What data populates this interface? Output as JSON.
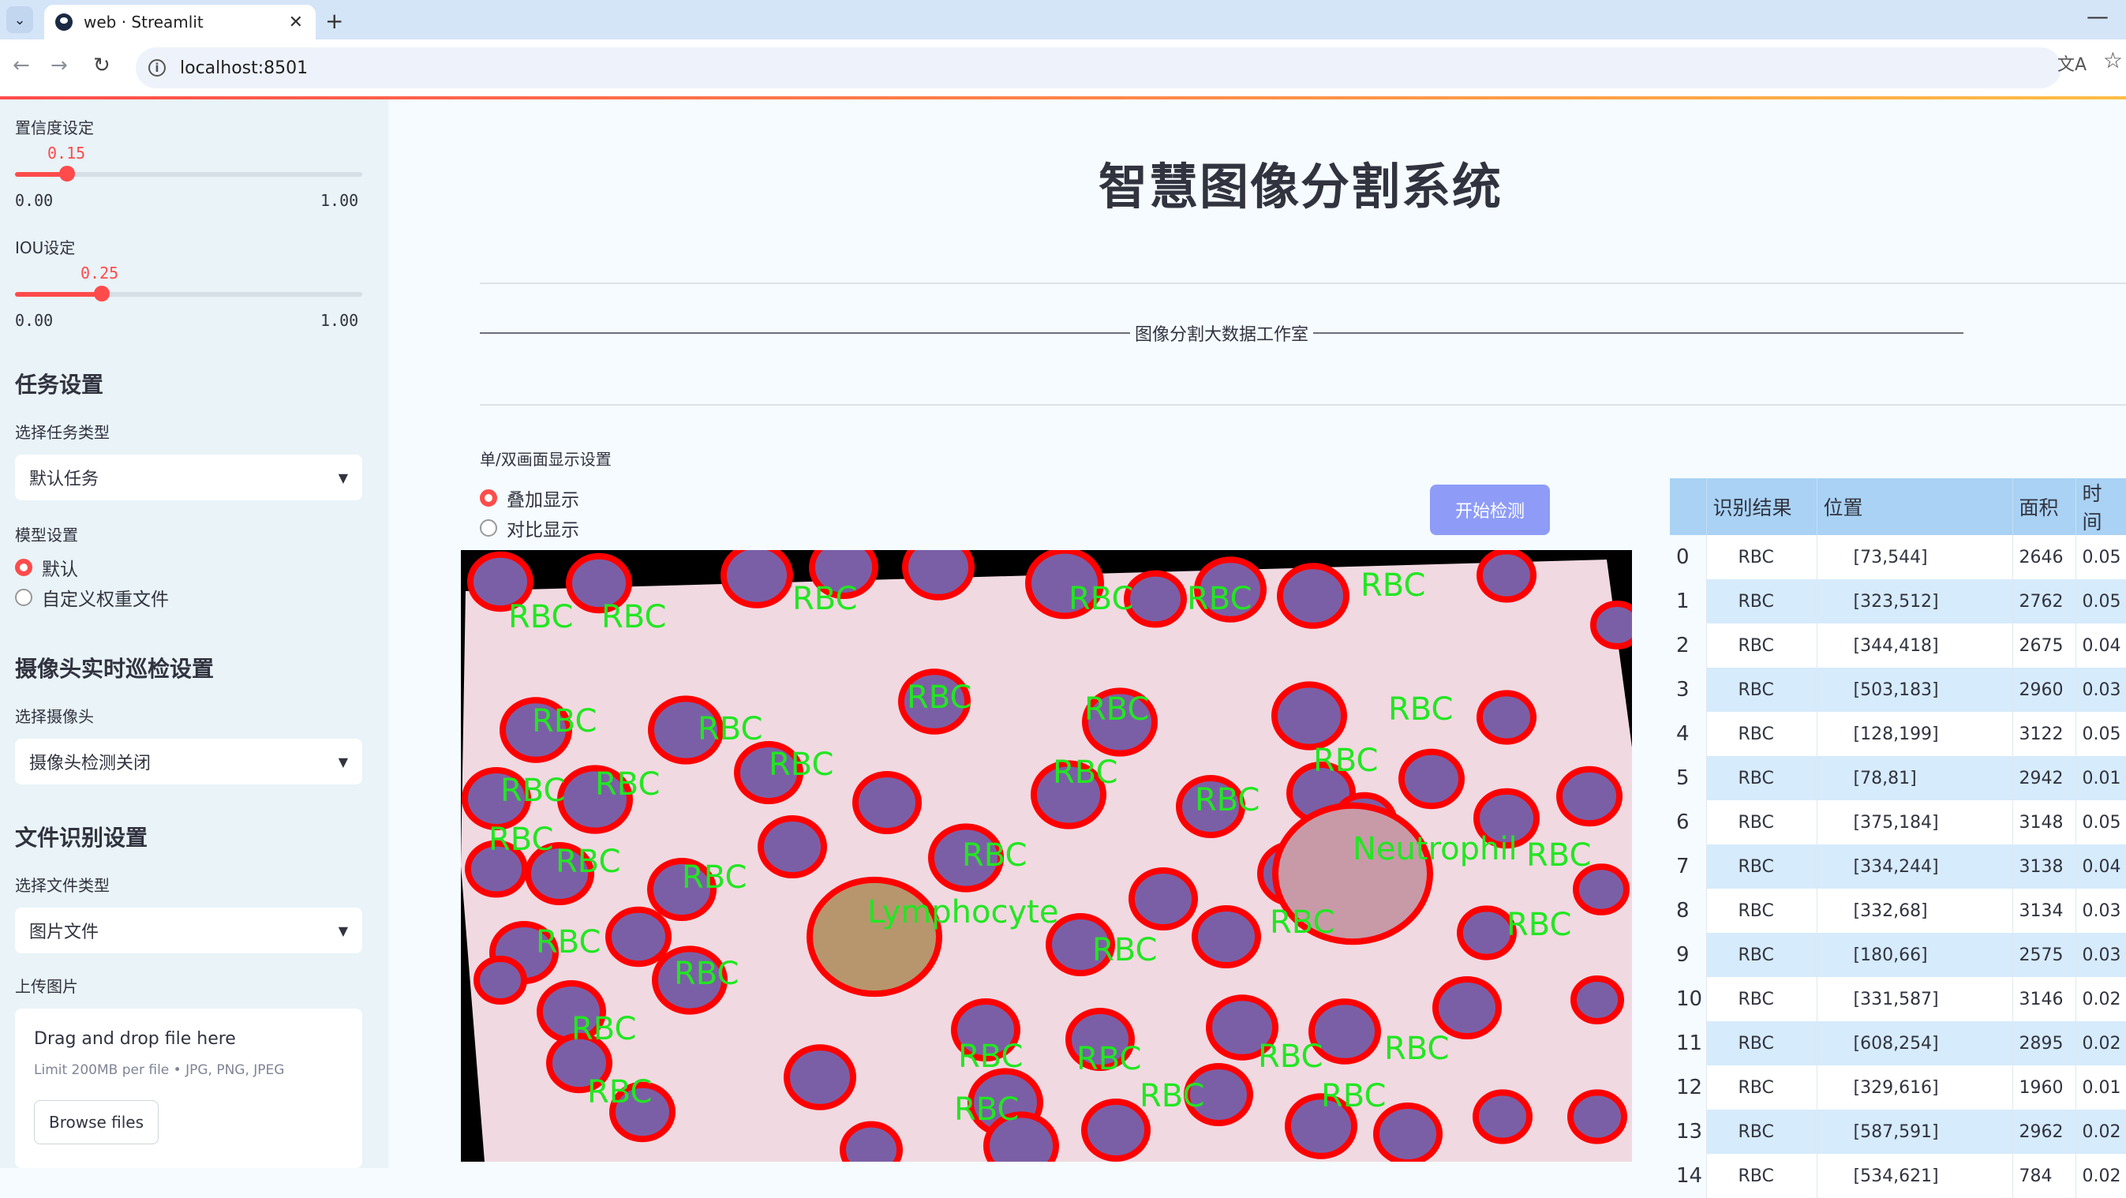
{
  "browser": {
    "tab_title": "web · Streamlit",
    "url": "localhost:8501",
    "new_tab": "+",
    "close": "✕",
    "minimize": "—"
  },
  "sidebar": {
    "confidence": {
      "label": "置信度设定",
      "value": "0.15",
      "min": "0.00",
      "max": "1.00",
      "fraction": 0.15
    },
    "iou": {
      "label": "IOU设定",
      "value": "0.25",
      "min": "0.00",
      "max": "1.00",
      "fraction": 0.25
    },
    "task_header": "任务设置",
    "task_type_label": "选择任务类型",
    "task_type_value": "默认任务",
    "model_label": "模型设置",
    "model_options": [
      "默认",
      "自定义权重文件"
    ],
    "model_selected": 0,
    "camera_header": "摄像头实时巡检设置",
    "camera_label": "选择摄像头",
    "camera_value": "摄像头检测关闭",
    "file_header": "文件识别设置",
    "file_type_label": "选择文件类型",
    "file_type_value": "图片文件",
    "upload_label": "上传图片",
    "upload_title": "Drag and drop file here",
    "upload_limit": "Limit 200MB per file • JPG, PNG, JPEG",
    "browse_button": "Browse files"
  },
  "main": {
    "title": "智慧图像分割系统",
    "studio": "图像分割大数据工作室",
    "display_label": "单/双画面显示设置",
    "display_options": [
      "叠加显示",
      "对比显示"
    ],
    "display_selected": 0,
    "start_button": "开始检测"
  },
  "image": {
    "cell_labels": [
      "RBC",
      "RBC",
      "RBC",
      "RBC",
      "RBC",
      "Lymphocyte",
      "Neutrophil"
    ],
    "label_color": "#22e622",
    "outline_color": "#ff0000"
  },
  "table": {
    "headers": [
      "",
      "识别结果",
      "位置",
      "面积",
      "时间"
    ],
    "rows": [
      [
        "0",
        "RBC",
        "[73,544]",
        "2646",
        "0.05"
      ],
      [
        "1",
        "RBC",
        "[323,512]",
        "2762",
        "0.05"
      ],
      [
        "2",
        "RBC",
        "[344,418]",
        "2675",
        "0.04"
      ],
      [
        "3",
        "RBC",
        "[503,183]",
        "2960",
        "0.03"
      ],
      [
        "4",
        "RBC",
        "[128,199]",
        "3122",
        "0.05"
      ],
      [
        "5",
        "RBC",
        "[78,81]",
        "2942",
        "0.01"
      ],
      [
        "6",
        "RBC",
        "[375,184]",
        "3148",
        "0.05"
      ],
      [
        "7",
        "RBC",
        "[334,244]",
        "3138",
        "0.04"
      ],
      [
        "8",
        "RBC",
        "[332,68]",
        "3134",
        "0.03"
      ],
      [
        "9",
        "RBC",
        "[180,66]",
        "2575",
        "0.03"
      ],
      [
        "10",
        "RBC",
        "[331,587]",
        "3146",
        "0.02"
      ],
      [
        "11",
        "RBC",
        "[608,254]",
        "2895",
        "0.02"
      ],
      [
        "12",
        "RBC",
        "[329,616]",
        "1960",
        "0.01"
      ],
      [
        "13",
        "RBC",
        "[587,591]",
        "2962",
        "0.02"
      ],
      [
        "14",
        "RBC",
        "[534,621]",
        "784",
        "0.02"
      ]
    ]
  }
}
